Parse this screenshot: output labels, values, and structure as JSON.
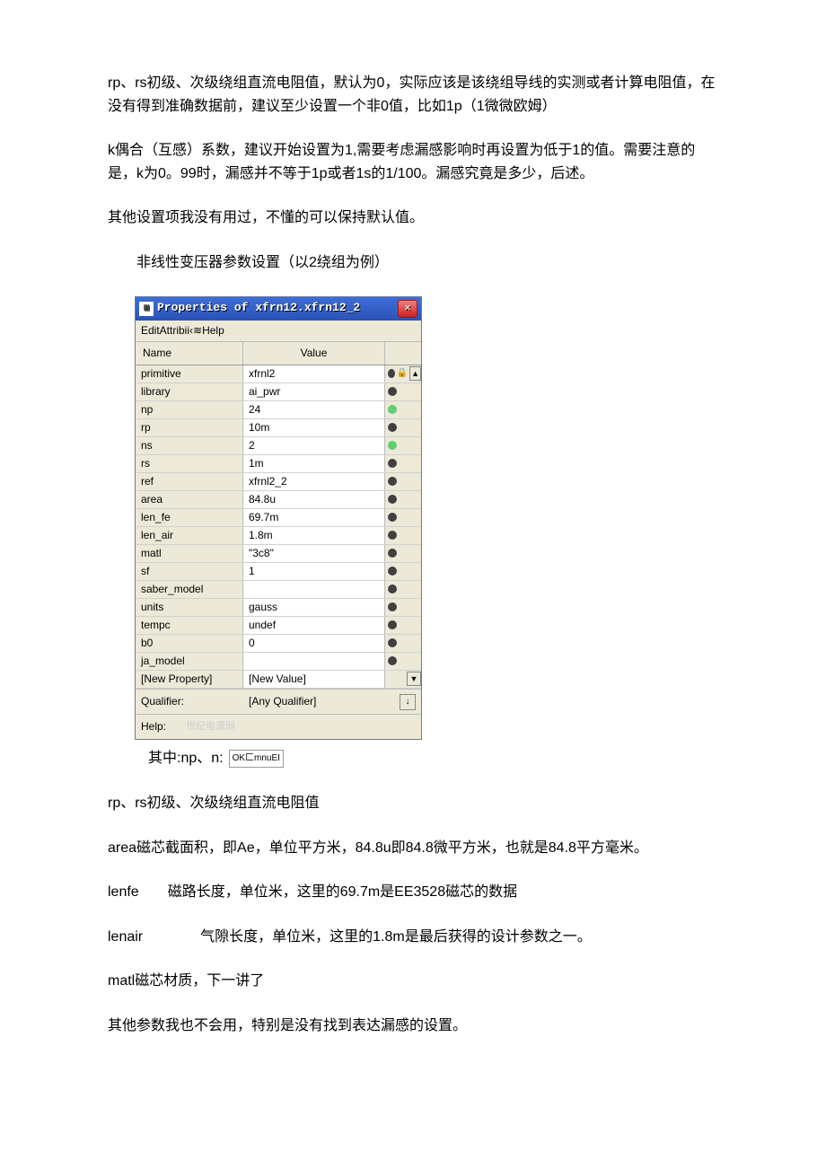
{
  "text": {
    "p1": "rp、rs初级、次级绕组直流电阻值，默认为0，实际应该是该绕组导线的实测或者计算电阻值，在没有得到准确数据前，建议至少设置一个非0值，比如1p（1微微欧姆）",
    "p2": "k偶合（互感）系数，建议开始设置为1,需要考虑漏感影响时再设置为低于1的值。需要注意的是，k为0。99时，漏感并不等于1p或者1s的1/100。漏感究竟是多少，后述。",
    "p3": "其他设置项我没有用过，不懂的可以保持默认值。",
    "p4": "非线性变压器参数设置（以2绕组为例）",
    "p5_prefix": "其中:np、n:",
    "p5_input": "OK匚mnuEI",
    "p6": "rp、rs初级、次级绕组直流电阻值",
    "p7": "area磁芯截面积，即Ae，单位平方米，84.8u即84.8微平方米，也就是84.8平方毫米。",
    "p8": "lenfe  磁路长度，单位米，这里的69.7m是EE3528磁芯的数据",
    "p9": "lenair    气隙长度，单位米，这里的1.8m是最后获得的设计参数之一。",
    "p10": "matl磁芯材质，下一讲了",
    "p11": "其他参数我也不会用，特别是没有找到表达漏感的设置。"
  },
  "dialog": {
    "title": "Properties of xfrn12.xfrn12_2",
    "menubar": "EditAttribii‹≋Help",
    "header_name": "Name",
    "header_value": "Value",
    "rows": [
      {
        "name": "primitive",
        "value": "xfrnl2",
        "dot": "dark",
        "lock": true,
        "up": true
      },
      {
        "name": "library",
        "value": "ai_pwr",
        "dot": "dark"
      },
      {
        "name": "np",
        "value": "24",
        "dot": "green"
      },
      {
        "name": "rp",
        "value": "10m",
        "dot": "dark"
      },
      {
        "name": "ns",
        "value": "2",
        "dot": "green"
      },
      {
        "name": "rs",
        "value": "1m",
        "dot": "dark"
      },
      {
        "name": "ref",
        "value": "xfrnl2_2",
        "dot": "dark"
      },
      {
        "name": "area",
        "value": "84.8u",
        "dot": "dark"
      },
      {
        "name": "len_fe",
        "value": "69.7m",
        "dot": "dark"
      },
      {
        "name": "len_air",
        "value": "1.8m",
        "dot": "dark"
      },
      {
        "name": "matl",
        "value": "\"3c8\"",
        "dot": "dark"
      },
      {
        "name": "sf",
        "value": "1",
        "dot": "dark"
      },
      {
        "name": "saber_model",
        "value": "",
        "dot": "dark"
      },
      {
        "name": "units",
        "value": "gauss",
        "dot": "dark"
      },
      {
        "name": "tempc",
        "value": "undef",
        "dot": "dark"
      },
      {
        "name": "b0",
        "value": "0",
        "dot": "dark"
      },
      {
        "name": "ja_model",
        "value": "",
        "dot": "dark"
      },
      {
        "name": "[New Property]",
        "value": "[New Value]",
        "dot": null,
        "down": true
      }
    ],
    "qualifier_label": "Qualifier:",
    "qualifier_value": "[Any Qualifier]",
    "help_label": "Help:",
    "watermark": "世纪电源网"
  }
}
